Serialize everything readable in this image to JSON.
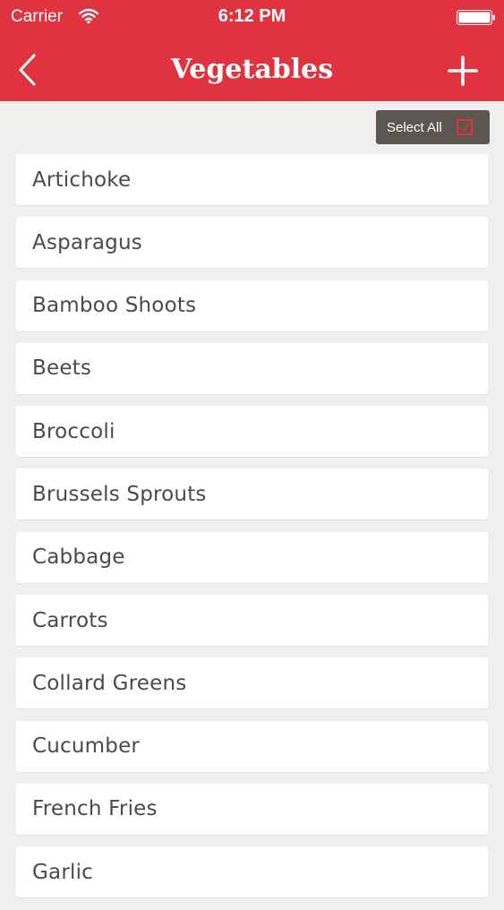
{
  "status_bar": {
    "carrier": "Carrier",
    "time": "6:12 PM",
    "wifi_icon": "wifi-icon",
    "battery_icon": "battery-icon"
  },
  "nav": {
    "title": "Vegetables",
    "back_icon": "chevron-left-icon",
    "add_icon": "plus-icon"
  },
  "select_all": {
    "label": "Select All",
    "checked": true
  },
  "colors": {
    "header": "#e0333f",
    "background": "#efefef",
    "select_all_bg": "#5d5650",
    "text": "#4a4a4a"
  },
  "items": [
    {
      "label": "Artichoke"
    },
    {
      "label": "Asparagus"
    },
    {
      "label": "Bamboo Shoots"
    },
    {
      "label": "Beets"
    },
    {
      "label": "Broccoli"
    },
    {
      "label": "Brussels Sprouts"
    },
    {
      "label": "Cabbage"
    },
    {
      "label": "Carrots"
    },
    {
      "label": "Collard Greens"
    },
    {
      "label": "Cucumber"
    },
    {
      "label": "French Fries"
    },
    {
      "label": "Garlic"
    }
  ]
}
